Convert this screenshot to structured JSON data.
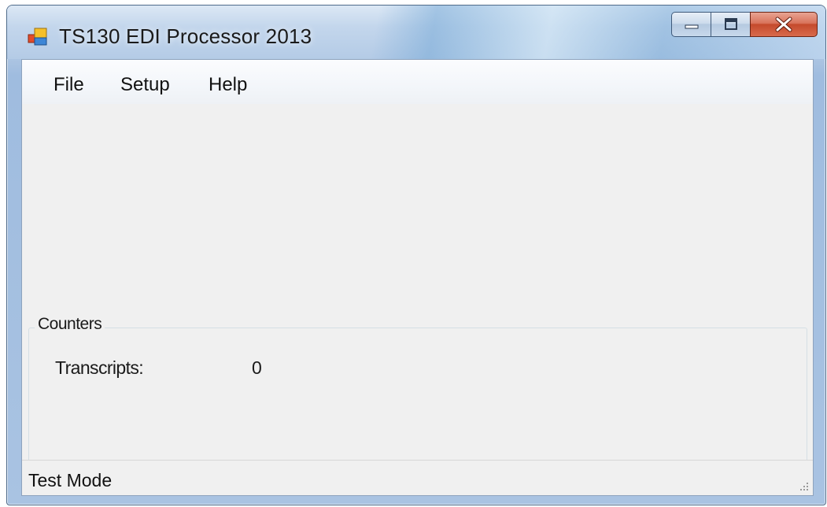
{
  "window": {
    "title": "TS130 EDI Processor 2013",
    "icon": "app-icon"
  },
  "menu": {
    "items": [
      {
        "label": "File"
      },
      {
        "label": "Setup"
      },
      {
        "label": "Help"
      }
    ]
  },
  "counters": {
    "group_label": "Counters",
    "transcripts_label": "Transcripts:",
    "transcripts_value": "0"
  },
  "status": {
    "text": "Test Mode"
  },
  "colors": {
    "client_bg": "#f0f0f0",
    "close_button": "#c44a2c",
    "frame": "#a9c3e2"
  }
}
